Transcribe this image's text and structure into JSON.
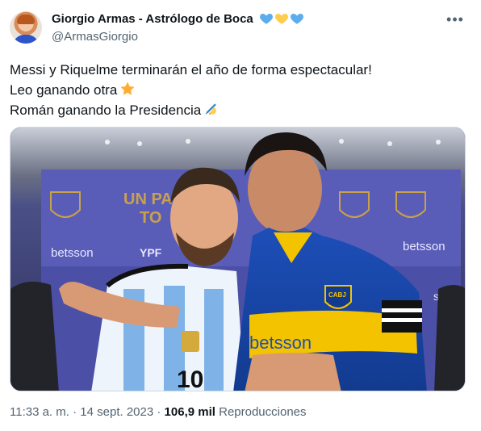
{
  "tweet": {
    "author_name": "Giorgio Armas - Astrólogo de Boca",
    "author_handle": "@ArmasGiorgio",
    "lines": [
      "Messi y Riquelme terminarán el año de forma espectacular!",
      "Leo ganando otra",
      "Román ganando la Presidencia"
    ],
    "emojis": [
      "star-icon",
      "writing-hand-icon"
    ],
    "name_emojis": [
      "blue-heart-icon",
      "yellow-heart-icon",
      "blue-heart-icon"
    ],
    "photo": {
      "description_labels": {
        "banner_text": "UN PA TO",
        "sponsor_1": "betsson",
        "sponsor_2": "YPF",
        "sponsor_3": "betsson",
        "sponsor_4": "ssoN",
        "jersey_right_sponsor": "betsson",
        "jersey_right_badge": "CABJ",
        "jersey_left_number": "10",
        "jersey_left_badge": "AFA"
      }
    },
    "time": "11:33 a. m.",
    "separator": "·",
    "date": "14 sept. 2023",
    "views_count": "106,9 mil",
    "views_label": "Reproducciones"
  },
  "colors": {
    "text_primary": "#0f1419",
    "text_secondary": "#536471",
    "heart_blue": "#5dadec",
    "heart_yellow": "#ffcc4d"
  }
}
